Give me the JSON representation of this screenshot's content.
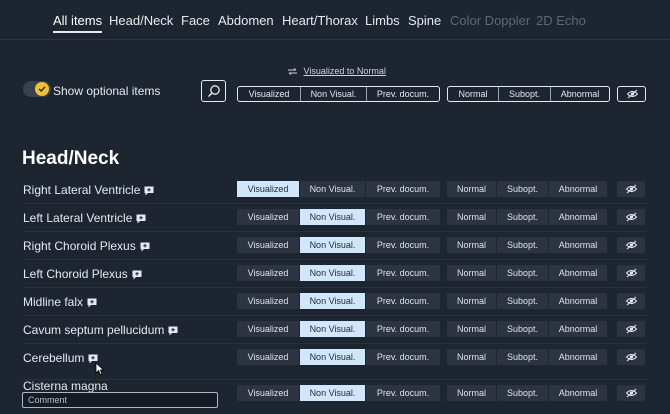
{
  "tabs": [
    {
      "label": "All items"
    },
    {
      "label": "Head/Neck"
    },
    {
      "label": "Face"
    },
    {
      "label": "Abdomen"
    },
    {
      "label": "Heart/Thorax"
    },
    {
      "label": "Limbs"
    },
    {
      "label": "Spine"
    },
    {
      "label": "Color Doppler"
    },
    {
      "label": "2D Echo"
    }
  ],
  "toolbar": {
    "optional_label": "Show optional items",
    "visualized_link": "Visualized to Normal",
    "visibility_options": [
      "Visualized",
      "Non Visual.",
      "Prev. docum."
    ],
    "quality_options": [
      "Normal",
      "Subopt.",
      "Abnormal"
    ]
  },
  "section": {
    "title": "Head/Neck",
    "items": [
      {
        "label": "Right Lateral Ventricle",
        "visibility": "Visualized"
      },
      {
        "label": "Left Lateral Ventricle",
        "visibility": "Non Visual."
      },
      {
        "label": "Right Choroid Plexus",
        "visibility": "Non Visual."
      },
      {
        "label": "Left Choroid Plexus",
        "visibility": "Non Visual."
      },
      {
        "label": "Midline falx",
        "visibility": "Non Visual."
      },
      {
        "label": "Cavum septum pellucidum",
        "visibility": "Non Visual."
      },
      {
        "label": "Cerebellum",
        "visibility": "Non Visual."
      },
      {
        "label": "Cisterna magna",
        "visibility": "Non Visual."
      }
    ],
    "comment_placeholder": "Comment"
  }
}
